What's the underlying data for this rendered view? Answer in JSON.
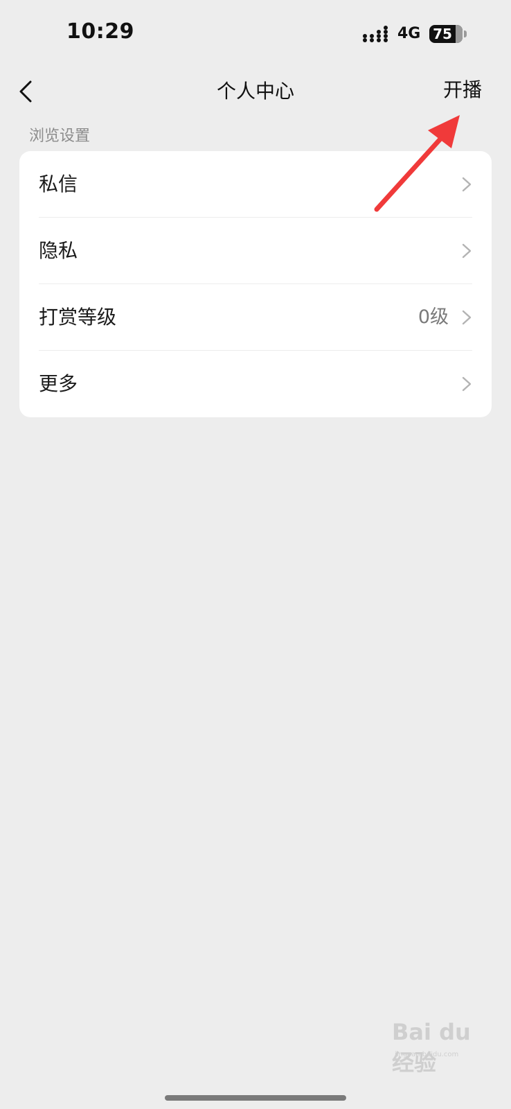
{
  "status_bar": {
    "time": "10:29",
    "network": "4G",
    "battery": "75"
  },
  "nav": {
    "title": "个人中心",
    "action_label": "开播"
  },
  "section": {
    "header": "浏览设置"
  },
  "settings": {
    "items": [
      {
        "label": "私信",
        "value": ""
      },
      {
        "label": "隐私",
        "value": ""
      },
      {
        "label": "打赏等级",
        "value": "0级"
      },
      {
        "label": "更多",
        "value": ""
      }
    ]
  },
  "watermark": {
    "logo": "Bai du 经验",
    "sub": "jingyan.baidu.com"
  },
  "colors": {
    "background": "#ededed",
    "card": "#ffffff",
    "annotation_arrow": "#f03a3a"
  }
}
